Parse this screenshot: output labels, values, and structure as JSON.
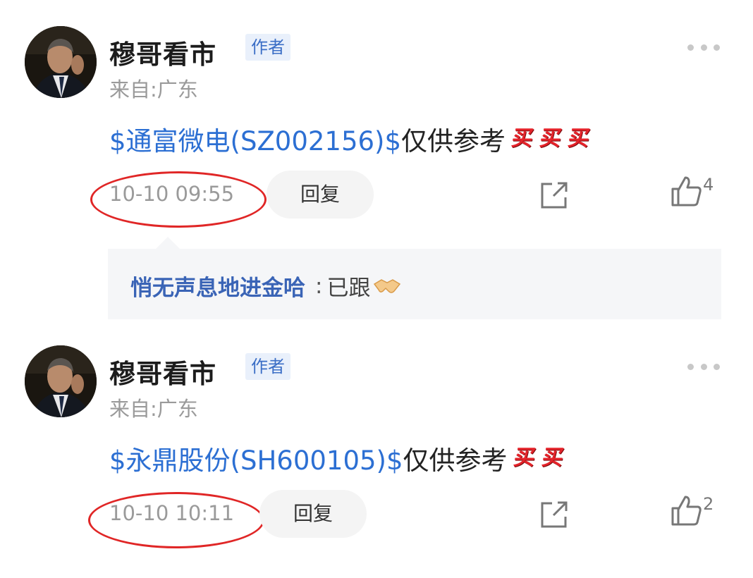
{
  "posts": [
    {
      "author": "穆哥看市",
      "author_badge": "作者",
      "location": "来自:广东",
      "stock_link": "$通富微电(SZ002156)$",
      "content_text": "仅供参考",
      "buy_emojis": [
        "买",
        "买",
        "买"
      ],
      "timestamp": "10-10 09:55",
      "reply_label": "回复",
      "like_count": "4",
      "replies": [
        {
          "user": "悄无声息地进金哈",
          "separator": ":",
          "text": "已跟",
          "emoji": "handshake-icon"
        }
      ]
    },
    {
      "author": "穆哥看市",
      "author_badge": "作者",
      "location": "来自:广东",
      "stock_link": "$永鼎股份(SH600105)$",
      "content_text": "仅供参考",
      "buy_emojis": [
        "买",
        "买"
      ],
      "timestamp": "10-10 10:11",
      "reply_label": "回复",
      "like_count": "2"
    }
  ],
  "colors": {
    "stock_link": "#2c6fd3",
    "highlight_circle": "#e02626",
    "reply_user": "#3a64b6",
    "badge_bg": "#e9f0fb",
    "badge_text": "#3b6ec6"
  }
}
